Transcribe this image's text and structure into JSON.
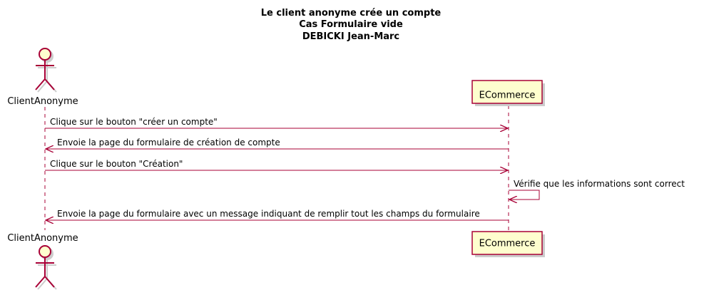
{
  "title_lines": [
    "Le client anonyme crée un compte",
    "Cas Formulaire vide",
    "DEBICKI Jean-Marc"
  ],
  "participants": {
    "actor": {
      "name": "ClientAnonyme"
    },
    "system": {
      "name": "ECommerce"
    }
  },
  "messages": [
    {
      "from": "ClientAnonyme",
      "to": "ECommerce",
      "text": "Clique sur le bouton \"créer un compte\""
    },
    {
      "from": "ECommerce",
      "to": "ClientAnonyme",
      "text": "Envoie la page du formulaire de création de compte"
    },
    {
      "from": "ClientAnonyme",
      "to": "ECommerce",
      "text": "Clique sur le bouton \"Création\""
    },
    {
      "from": "ECommerce",
      "to": "ECommerce",
      "text": "Vérifie que les informations sont correct"
    },
    {
      "from": "ECommerce",
      "to": "ClientAnonyme",
      "text": "Envoie la page du formulaire avec un message indiquant de remplir tout les champs du formulaire"
    }
  ],
  "colors": {
    "border": "#a80036",
    "participant_fill": "#fefece",
    "lifeline": "#a80036",
    "shadow": "#cccccc"
  }
}
